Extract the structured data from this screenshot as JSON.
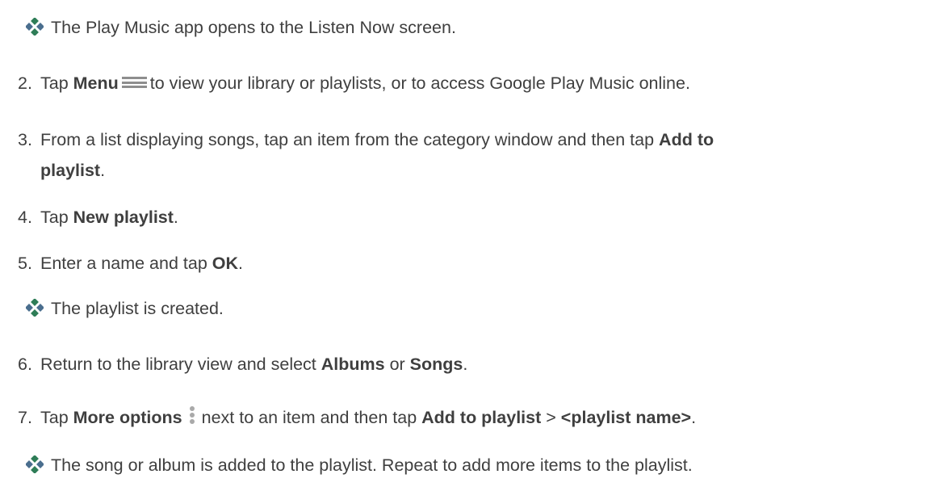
{
  "result1": "The Play Music app opens to the Listen Now screen.",
  "step2": {
    "num": "2.",
    "pre": "Tap ",
    "bold": "Menu",
    "post": "to view your library or playlists, or to access Google Play Music online.",
    "icon": "menu-icon"
  },
  "step3": {
    "num": "3.",
    "pre": "From a list displaying songs, tap an item from the category window and then tap ",
    "bold1": "Add to",
    "bold2": "playlist",
    "post": "."
  },
  "step4": {
    "num": "4.",
    "pre": "Tap ",
    "bold": "New playlist",
    "post": "."
  },
  "step5": {
    "num": "5.",
    "pre": "Enter a name and tap ",
    "bold": "OK",
    "post": "."
  },
  "result2": "The playlist is created.",
  "step6": {
    "num": "6.",
    "pre": "Return to the library view and select ",
    "bold1": "Albums",
    "mid": " or ",
    "bold2": "Songs",
    "post": "."
  },
  "step7": {
    "num": "7.",
    "pre": "Tap ",
    "bold1": "More options",
    "mid": "next to an item and then tap ",
    "bold2": "Add to playlist",
    "sep": " > ",
    "bold3": "<playlist name>",
    "post": ".",
    "icon": "more-options-icon"
  },
  "result3": "The song or album is added to the playlist. Repeat to add more items to the playlist.",
  "result_icon": "diamond-bullet-icon"
}
